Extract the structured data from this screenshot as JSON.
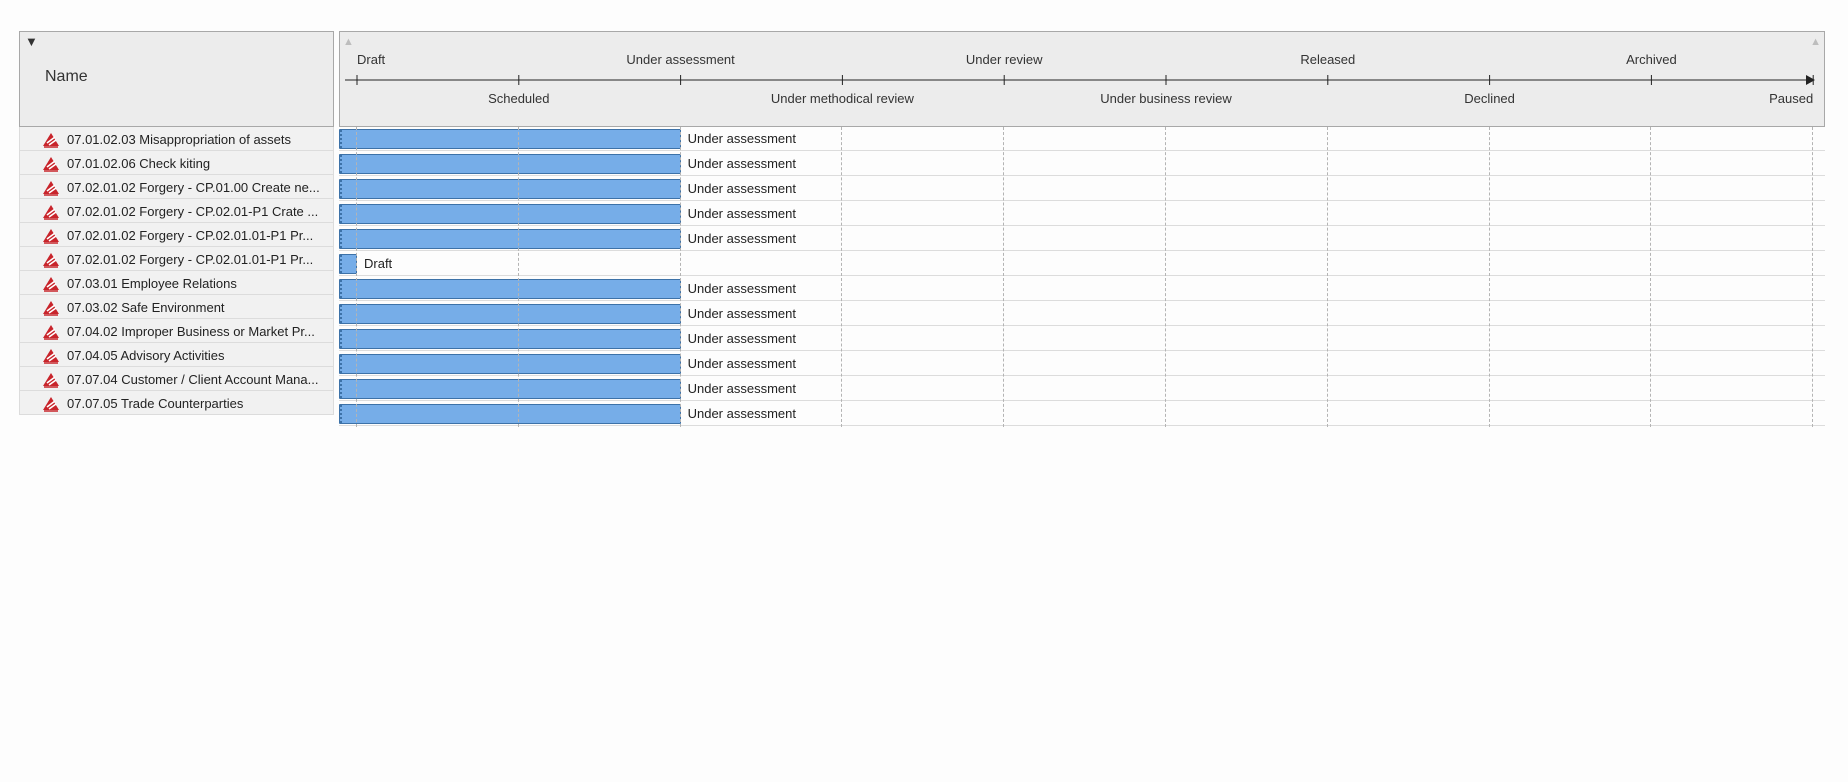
{
  "left_header": {
    "collapse_icon": "triangle-down",
    "name_label": "Name"
  },
  "timeline": {
    "top_labels": [
      "Draft",
      "Under assessment",
      "Under review",
      "Released",
      "Archived"
    ],
    "bottom_labels": [
      "Scheduled",
      "Under methodical review",
      "Under business review",
      "Declined",
      "Paused"
    ],
    "scroll_left_icon": "triangle-up",
    "scroll_right_icon": "triangle-up"
  },
  "colors": {
    "bar_fill": "#76ade8",
    "bar_border": "#3d72a8",
    "risk_icon": "#c8242b"
  },
  "rows": [
    {
      "name": "07.01.02.03 Misappropriation of assets",
      "status": "Under assessment",
      "stage": "Under assessment"
    },
    {
      "name": "07.01.02.06 Check kiting",
      "status": "Under assessment",
      "stage": "Under assessment"
    },
    {
      "name": "07.02.01.02 Forgery - CP.01.00 Create ne...",
      "status": "Under assessment",
      "stage": "Under assessment"
    },
    {
      "name": "07.02.01.02 Forgery - CP.02.01-P1 Crate ...",
      "status": "Under assessment",
      "stage": "Under assessment"
    },
    {
      "name": "07.02.01.02 Forgery - CP.02.01.01-P1 Pr...",
      "status": "Under assessment",
      "stage": "Under assessment"
    },
    {
      "name": "07.02.01.02 Forgery - CP.02.01.01-P1 Pr...",
      "status": "Draft",
      "stage": "Draft"
    },
    {
      "name": "07.03.01 Employee Relations",
      "status": "Under assessment",
      "stage": "Under assessment"
    },
    {
      "name": "07.03.02 Safe Environment",
      "status": "Under assessment",
      "stage": "Under assessment"
    },
    {
      "name": "07.04.02 Improper Business or Market Pr...",
      "status": "Under assessment",
      "stage": "Under assessment"
    },
    {
      "name": "07.04.05 Advisory Activities",
      "status": "Under assessment",
      "stage": "Under assessment"
    },
    {
      "name": "07.07.04 Customer / Client Account Mana...",
      "status": "Under assessment",
      "stage": "Under assessment"
    },
    {
      "name": "07.07.05 Trade Counterparties",
      "status": "Under assessment",
      "stage": "Under assessment"
    }
  ]
}
